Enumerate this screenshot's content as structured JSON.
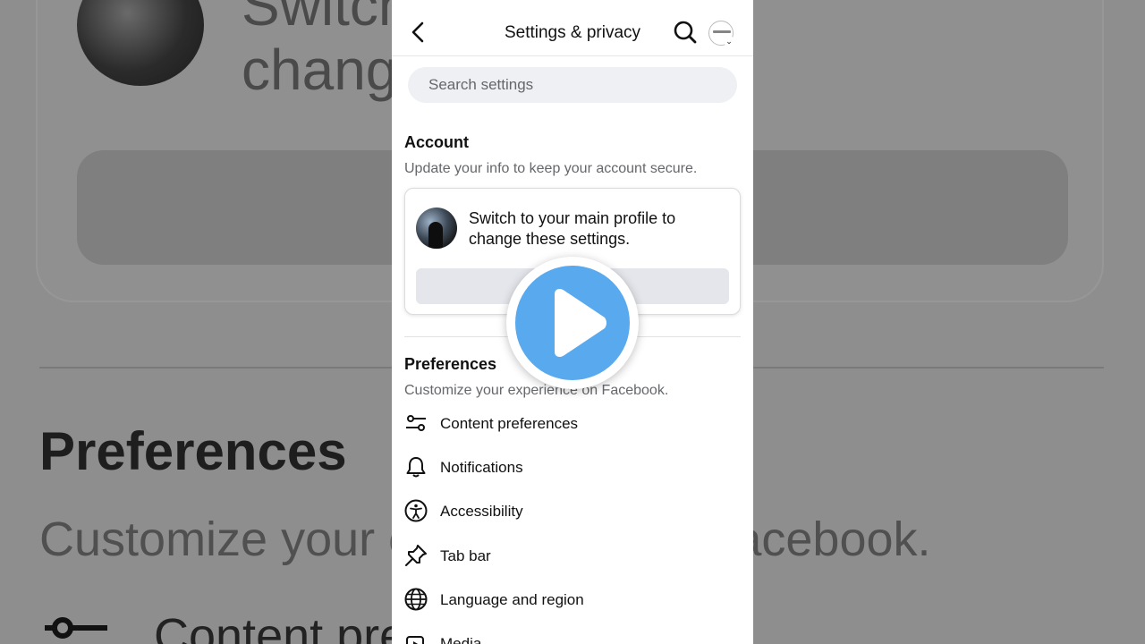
{
  "background": {
    "switch_text": "Switch to your main profile to change these settings.",
    "preferences_heading": "Preferences",
    "preferences_sub": "Customize your experience on Facebook.",
    "content_item": "Content preferences"
  },
  "header": {
    "title": "Settings & privacy",
    "back_icon": "chevron-left-icon",
    "search_icon": "search-icon"
  },
  "search": {
    "placeholder": "Search settings"
  },
  "account": {
    "heading": "Account",
    "subtitle": "Update your info to keep your account secure.",
    "card_text": "Switch to your main profile to change these settings."
  },
  "preferences": {
    "heading": "Preferences",
    "subtitle": "Customize your experience on Facebook.",
    "items": [
      {
        "label": "Content preferences",
        "icon": "sliders-icon"
      },
      {
        "label": "Notifications",
        "icon": "bell-icon"
      },
      {
        "label": "Accessibility",
        "icon": "accessibility-icon"
      },
      {
        "label": "Tab bar",
        "icon": "pin-icon"
      },
      {
        "label": "Language and region",
        "icon": "globe-icon"
      },
      {
        "label": "Media",
        "icon": "media-icon"
      }
    ]
  },
  "overlay": {
    "play_icon": "play-icon",
    "accent": "#58a9ee"
  }
}
